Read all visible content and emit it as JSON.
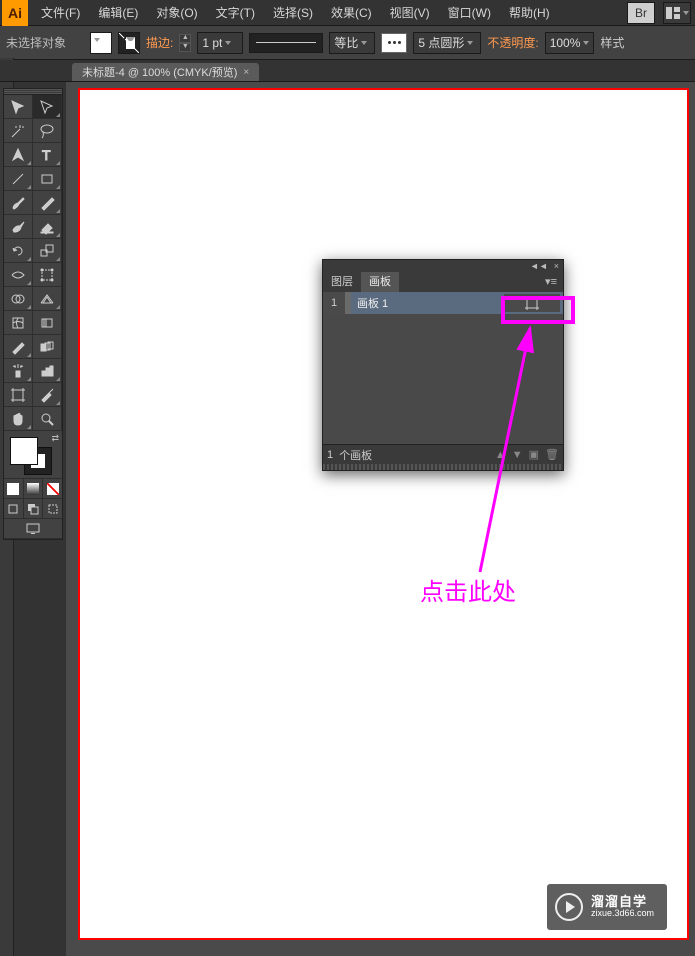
{
  "menu": {
    "file": "文件(F)",
    "edit": "编辑(E)",
    "object": "对象(O)",
    "type": "文字(T)",
    "select": "选择(S)",
    "effect": "效果(C)",
    "view": "视图(V)",
    "window": "窗口(W)",
    "help": "帮助(H)",
    "br_icon": "Br"
  },
  "options": {
    "selection_status": "未选择对象",
    "stroke_label": "描边:",
    "stroke_weight": "1 pt",
    "profile_label": "等比",
    "brush_value": "5 点圆形",
    "opacity_label": "不透明度:",
    "opacity_value": "100%",
    "style_label": "样式"
  },
  "doc": {
    "title": "未标题-4 @ 100% (CMYK/预览)"
  },
  "panel": {
    "tab_layers": "图层",
    "tab_artboards": "画板",
    "row_num": "1",
    "row_name": "画板 1",
    "count": "1",
    "count_label": "个画板"
  },
  "annotation": {
    "text": "点击此处"
  },
  "watermark": {
    "line1": "溜溜自学",
    "line2": "zixue.3d66.com"
  }
}
